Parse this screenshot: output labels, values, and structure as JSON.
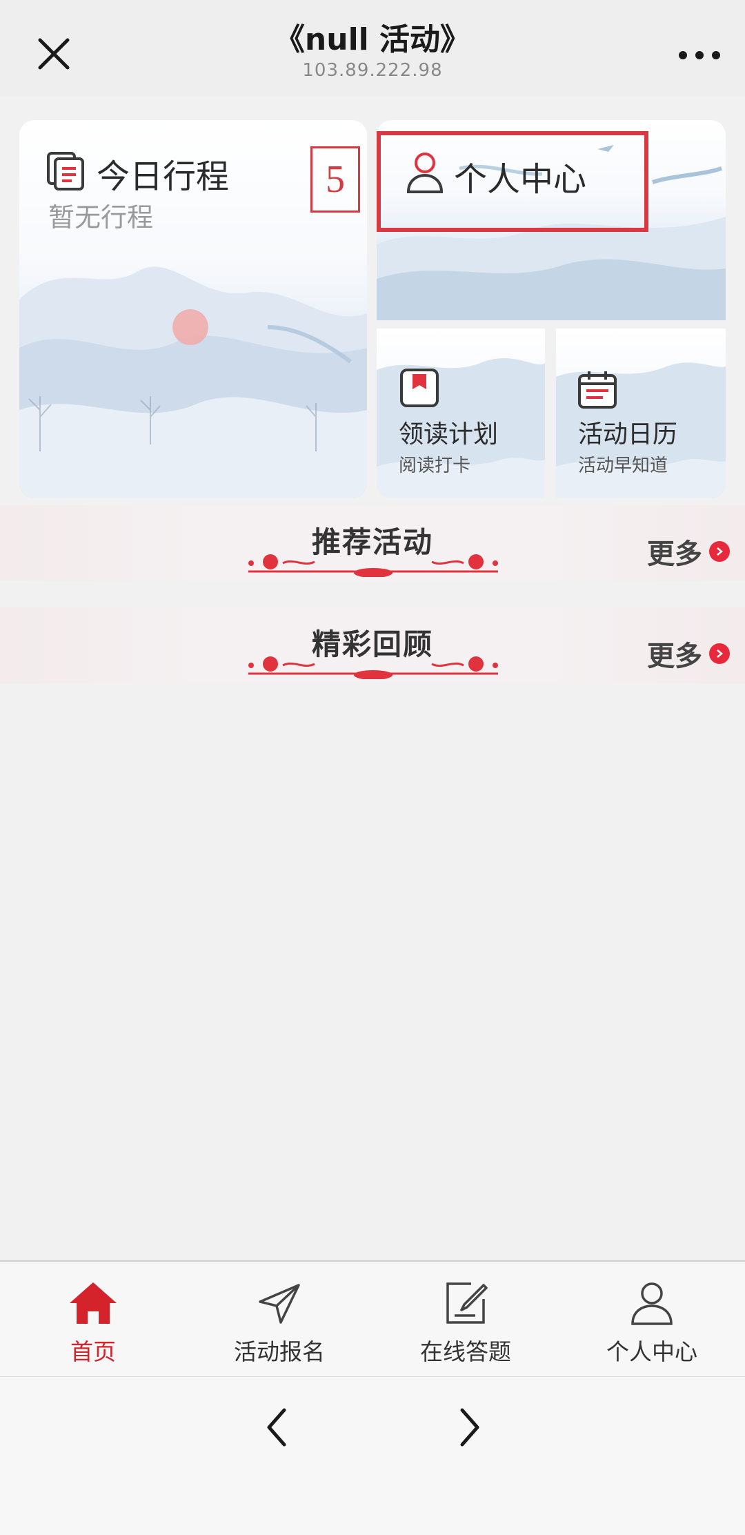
{
  "header": {
    "title": "《null 活动》",
    "subtitle": "103.89.222.98"
  },
  "cards": {
    "itinerary": {
      "title": "今日行程",
      "subtitle": "暂无行程",
      "icon": "document-list-icon"
    },
    "personal": {
      "title": "个人中心",
      "icon": "user-icon"
    },
    "reading": {
      "title": "领读计划",
      "subtitle": "阅读打卡",
      "icon": "bookmark-icon"
    },
    "calendar": {
      "title": "活动日历",
      "subtitle": "活动早知道",
      "icon": "calendar-icon"
    }
  },
  "annotation": {
    "number": "5"
  },
  "sections": [
    {
      "title": "推荐活动",
      "more": "更多"
    },
    {
      "title": "精彩回顾",
      "more": "更多"
    }
  ],
  "tabbar": [
    {
      "label": "首页",
      "icon": "home-icon",
      "active": true
    },
    {
      "label": "活动报名",
      "icon": "send-icon",
      "active": false
    },
    {
      "label": "在线答题",
      "icon": "edit-icon",
      "active": false
    },
    {
      "label": "个人中心",
      "icon": "user-icon",
      "active": false
    }
  ],
  "colors": {
    "accent": "#d4232b",
    "highlight": "#d8383f",
    "more_dot": "#e8283b"
  }
}
